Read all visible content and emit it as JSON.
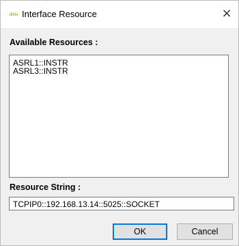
{
  "window": {
    "title": "Interface Resource",
    "close_glyph": "×",
    "icon": "app-icon"
  },
  "available": {
    "label": "Available Resources :",
    "items": [
      "ASRL1::INSTR",
      "ASRL3::INSTR"
    ]
  },
  "resource": {
    "label": "Resource String :",
    "value": "TCPIP0::192.168.13.14::5025::SOCKET"
  },
  "buttons": {
    "ok_label": "OK",
    "cancel_label": "Cancel"
  },
  "colors": {
    "accent": "#0078d7",
    "dialog_background": "#f0f0f0"
  }
}
